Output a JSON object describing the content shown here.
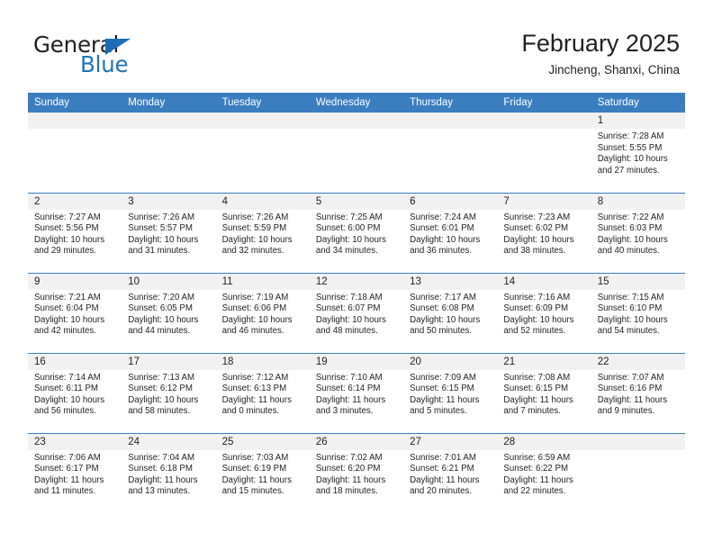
{
  "brand": {
    "name_top": "General",
    "name_bottom": "Blue",
    "accent_color": "#1c74bb",
    "flag_icon": "triangle-flag-icon"
  },
  "header": {
    "title": "February 2025",
    "location": "Jincheng, Shanxi, China"
  },
  "theme": {
    "header_bg": "#3a7ec0",
    "header_text": "#ffffff",
    "daynum_band_bg": "#f1f1f1",
    "cell_bg": "#ffffff",
    "row_separator": "#3a7ec0",
    "text": "#231f20"
  },
  "weekday_headers": [
    "Sunday",
    "Monday",
    "Tuesday",
    "Wednesday",
    "Thursday",
    "Friday",
    "Saturday"
  ],
  "labels": {
    "sunrise": "Sunrise:",
    "sunset": "Sunset:",
    "daylight": "Daylight:"
  },
  "weeks": [
    [
      {
        "day": "",
        "empty": true
      },
      {
        "day": "",
        "empty": true
      },
      {
        "day": "",
        "empty": true
      },
      {
        "day": "",
        "empty": true
      },
      {
        "day": "",
        "empty": true
      },
      {
        "day": "",
        "empty": true
      },
      {
        "day": "1",
        "sunrise": "Sunrise: 7:28 AM",
        "sunset": "Sunset: 5:55 PM",
        "daylight": "Daylight: 10 hours and 27 minutes."
      }
    ],
    [
      {
        "day": "2",
        "sunrise": "Sunrise: 7:27 AM",
        "sunset": "Sunset: 5:56 PM",
        "daylight": "Daylight: 10 hours and 29 minutes."
      },
      {
        "day": "3",
        "sunrise": "Sunrise: 7:26 AM",
        "sunset": "Sunset: 5:57 PM",
        "daylight": "Daylight: 10 hours and 31 minutes."
      },
      {
        "day": "4",
        "sunrise": "Sunrise: 7:26 AM",
        "sunset": "Sunset: 5:59 PM",
        "daylight": "Daylight: 10 hours and 32 minutes."
      },
      {
        "day": "5",
        "sunrise": "Sunrise: 7:25 AM",
        "sunset": "Sunset: 6:00 PM",
        "daylight": "Daylight: 10 hours and 34 minutes."
      },
      {
        "day": "6",
        "sunrise": "Sunrise: 7:24 AM",
        "sunset": "Sunset: 6:01 PM",
        "daylight": "Daylight: 10 hours and 36 minutes."
      },
      {
        "day": "7",
        "sunrise": "Sunrise: 7:23 AM",
        "sunset": "Sunset: 6:02 PM",
        "daylight": "Daylight: 10 hours and 38 minutes."
      },
      {
        "day": "8",
        "sunrise": "Sunrise: 7:22 AM",
        "sunset": "Sunset: 6:03 PM",
        "daylight": "Daylight: 10 hours and 40 minutes."
      }
    ],
    [
      {
        "day": "9",
        "sunrise": "Sunrise: 7:21 AM",
        "sunset": "Sunset: 6:04 PM",
        "daylight": "Daylight: 10 hours and 42 minutes."
      },
      {
        "day": "10",
        "sunrise": "Sunrise: 7:20 AM",
        "sunset": "Sunset: 6:05 PM",
        "daylight": "Daylight: 10 hours and 44 minutes."
      },
      {
        "day": "11",
        "sunrise": "Sunrise: 7:19 AM",
        "sunset": "Sunset: 6:06 PM",
        "daylight": "Daylight: 10 hours and 46 minutes."
      },
      {
        "day": "12",
        "sunrise": "Sunrise: 7:18 AM",
        "sunset": "Sunset: 6:07 PM",
        "daylight": "Daylight: 10 hours and 48 minutes."
      },
      {
        "day": "13",
        "sunrise": "Sunrise: 7:17 AM",
        "sunset": "Sunset: 6:08 PM",
        "daylight": "Daylight: 10 hours and 50 minutes."
      },
      {
        "day": "14",
        "sunrise": "Sunrise: 7:16 AM",
        "sunset": "Sunset: 6:09 PM",
        "daylight": "Daylight: 10 hours and 52 minutes."
      },
      {
        "day": "15",
        "sunrise": "Sunrise: 7:15 AM",
        "sunset": "Sunset: 6:10 PM",
        "daylight": "Daylight: 10 hours and 54 minutes."
      }
    ],
    [
      {
        "day": "16",
        "sunrise": "Sunrise: 7:14 AM",
        "sunset": "Sunset: 6:11 PM",
        "daylight": "Daylight: 10 hours and 56 minutes."
      },
      {
        "day": "17",
        "sunrise": "Sunrise: 7:13 AM",
        "sunset": "Sunset: 6:12 PM",
        "daylight": "Daylight: 10 hours and 58 minutes."
      },
      {
        "day": "18",
        "sunrise": "Sunrise: 7:12 AM",
        "sunset": "Sunset: 6:13 PM",
        "daylight": "Daylight: 11 hours and 0 minutes."
      },
      {
        "day": "19",
        "sunrise": "Sunrise: 7:10 AM",
        "sunset": "Sunset: 6:14 PM",
        "daylight": "Daylight: 11 hours and 3 minutes."
      },
      {
        "day": "20",
        "sunrise": "Sunrise: 7:09 AM",
        "sunset": "Sunset: 6:15 PM",
        "daylight": "Daylight: 11 hours and 5 minutes."
      },
      {
        "day": "21",
        "sunrise": "Sunrise: 7:08 AM",
        "sunset": "Sunset: 6:15 PM",
        "daylight": "Daylight: 11 hours and 7 minutes."
      },
      {
        "day": "22",
        "sunrise": "Sunrise: 7:07 AM",
        "sunset": "Sunset: 6:16 PM",
        "daylight": "Daylight: 11 hours and 9 minutes."
      }
    ],
    [
      {
        "day": "23",
        "sunrise": "Sunrise: 7:06 AM",
        "sunset": "Sunset: 6:17 PM",
        "daylight": "Daylight: 11 hours and 11 minutes."
      },
      {
        "day": "24",
        "sunrise": "Sunrise: 7:04 AM",
        "sunset": "Sunset: 6:18 PM",
        "daylight": "Daylight: 11 hours and 13 minutes."
      },
      {
        "day": "25",
        "sunrise": "Sunrise: 7:03 AM",
        "sunset": "Sunset: 6:19 PM",
        "daylight": "Daylight: 11 hours and 15 minutes."
      },
      {
        "day": "26",
        "sunrise": "Sunrise: 7:02 AM",
        "sunset": "Sunset: 6:20 PM",
        "daylight": "Daylight: 11 hours and 18 minutes."
      },
      {
        "day": "27",
        "sunrise": "Sunrise: 7:01 AM",
        "sunset": "Sunset: 6:21 PM",
        "daylight": "Daylight: 11 hours and 20 minutes."
      },
      {
        "day": "28",
        "sunrise": "Sunrise: 6:59 AM",
        "sunset": "Sunset: 6:22 PM",
        "daylight": "Daylight: 11 hours and 22 minutes."
      },
      {
        "day": "",
        "empty": true
      }
    ]
  ]
}
